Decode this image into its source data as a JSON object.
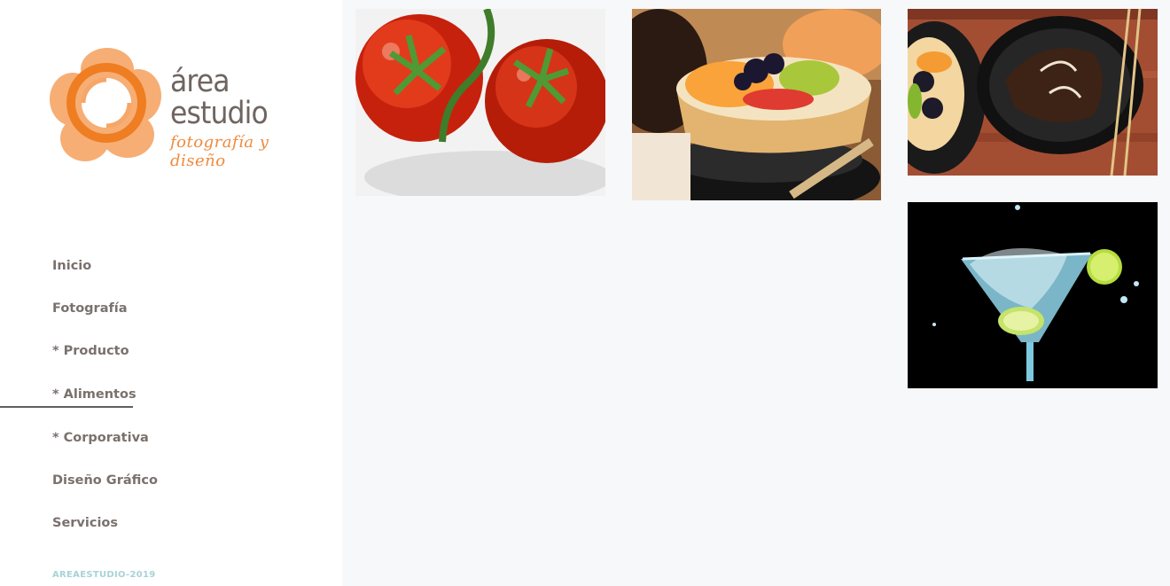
{
  "brand": {
    "line1": "área",
    "line2": "estudio",
    "tagline": "fotografía y diseño",
    "colors": {
      "orange": "#f39a4e",
      "text": "#6f6560"
    }
  },
  "nav": {
    "items": [
      {
        "label": "Inicio"
      },
      {
        "label": "Fotografía"
      },
      {
        "label": "* Producto"
      },
      {
        "label": "* Alimentos"
      },
      {
        "label": "* Corporativa"
      },
      {
        "label": "Diseño Gráfico"
      },
      {
        "label": "Servicios"
      }
    ],
    "active_index": 3
  },
  "footer": {
    "text": "AREAESTUDIO-2019"
  },
  "gallery": {
    "photos": [
      {
        "subject": "tomatoes"
      },
      {
        "subject": "fruit-tart"
      },
      {
        "subject": "chocolate-dessert"
      },
      {
        "subject": "cocktail"
      }
    ]
  }
}
